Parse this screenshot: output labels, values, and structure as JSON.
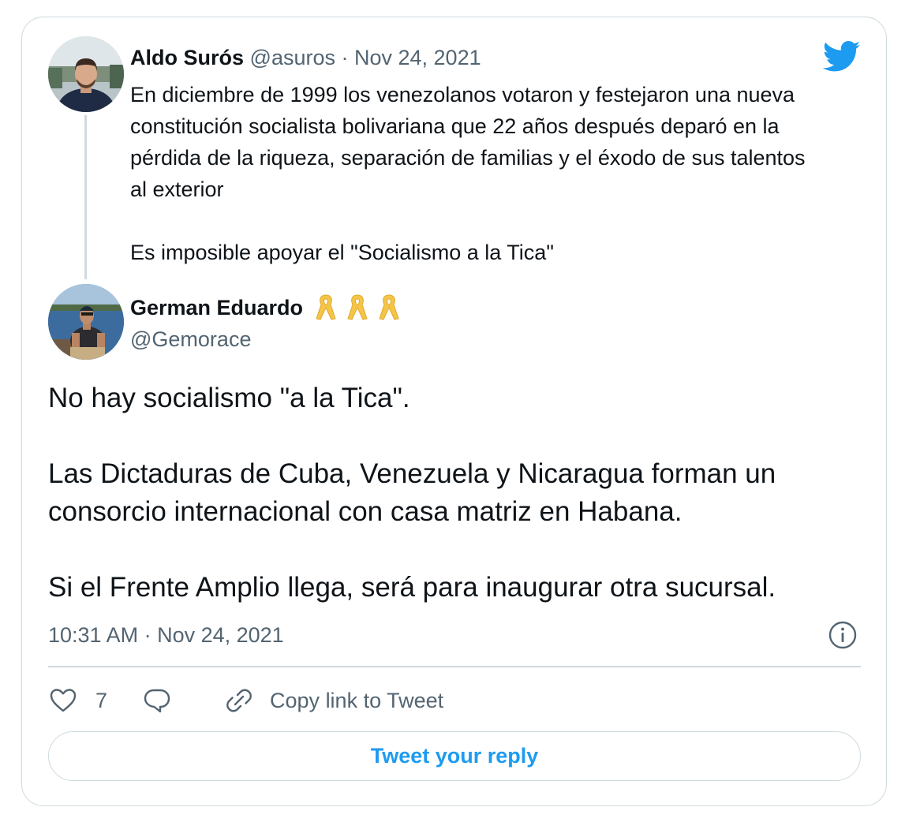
{
  "parent_tweet": {
    "name": "Aldo Surós",
    "handle": "@asuros",
    "separator": " · ",
    "date": "Nov 24, 2021",
    "text_lines": [
      "En diciembre de 1999 los venezolanos votaron y festejaron una nueva constitución socialista bolivariana que 22 años después deparó en la pérdida de la riqueza, separación de familias y el éxodo de sus talentos al exterior",
      "Es imposible apoyar el \"Socialismo a la Tica\""
    ]
  },
  "tweet": {
    "name": "German Eduardo",
    "ribbon_icon": "yellow-ribbon",
    "ribbon_count": 3,
    "handle": "@Gemorace",
    "paragraphs": [
      "No hay socialismo \"a la Tica\".",
      "Las Dictaduras de Cuba, Venezuela y Nicaragua forman un consorcio internacional con casa matriz en Habana.",
      "Si el Frente Amplio llega, será para inaugurar otra sucursal."
    ],
    "timestamp": "10:31 AM · Nov 24, 2021"
  },
  "actions": {
    "like_count": "7",
    "copy_link_label": "Copy link to Tweet"
  },
  "reply": {
    "label": "Tweet your reply"
  },
  "colors": {
    "accent": "#1d9bf0",
    "muted": "#536471",
    "border": "#cfd9de",
    "ribbon": "#f4c548"
  }
}
